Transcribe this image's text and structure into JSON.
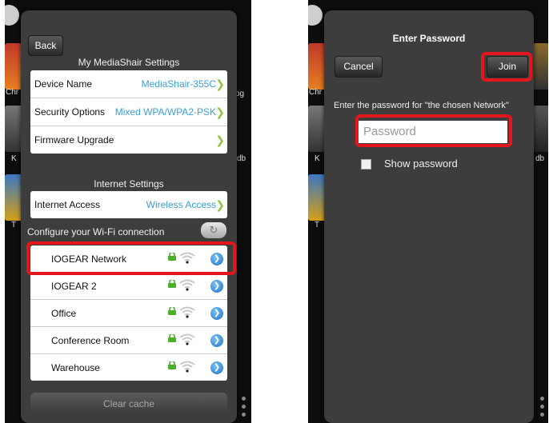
{
  "left_screen": {
    "back_label": "Back",
    "settings_title": "My MediaShair Settings",
    "settings_rows": [
      {
        "label": "Device Name",
        "value": "MediaShair-355C"
      },
      {
        "label": "Security Options",
        "value": "Mixed WPA/WPA2-PSK"
      },
      {
        "label": "Firmware Upgrade",
        "value": ""
      }
    ],
    "internet_title": "Internet Settings",
    "internet_row": {
      "label": "Internet Access",
      "value": "Wireless Access"
    },
    "wifi_heading": "Configure your Wi-Fi connection",
    "networks": [
      {
        "name": "IOGEAR Network",
        "selected": true
      },
      {
        "name": "IOGEAR 2",
        "selected": false
      },
      {
        "name": "Office",
        "selected": false
      },
      {
        "name": "Conference Room",
        "selected": false
      },
      {
        "name": "Warehouse",
        "selected": false
      }
    ],
    "clear_cache_label": "Clear cache",
    "background_fragments": [
      "Chr",
      "K",
      "T",
      "og",
      "db"
    ]
  },
  "right_screen": {
    "title": "Enter Password",
    "cancel_label": "Cancel",
    "join_label": "Join",
    "hint": "Enter the password for \"the chosen Network\"",
    "password_placeholder": "Password",
    "show_password_label": "Show password",
    "show_password_checked": false,
    "background_fragments": [
      "Chr",
      "K",
      "T",
      "db"
    ]
  },
  "colors": {
    "panel": "#3d3d3d",
    "value_blue": "#3aa0d8",
    "chevron_green": "#8dc63f",
    "highlight_red": "#e3161b",
    "lock_green": "#4caf2a"
  },
  "icons": [
    "lock-icon",
    "wifi-icon",
    "arrow-icon",
    "refresh-icon",
    "chevron-right-icon"
  ]
}
